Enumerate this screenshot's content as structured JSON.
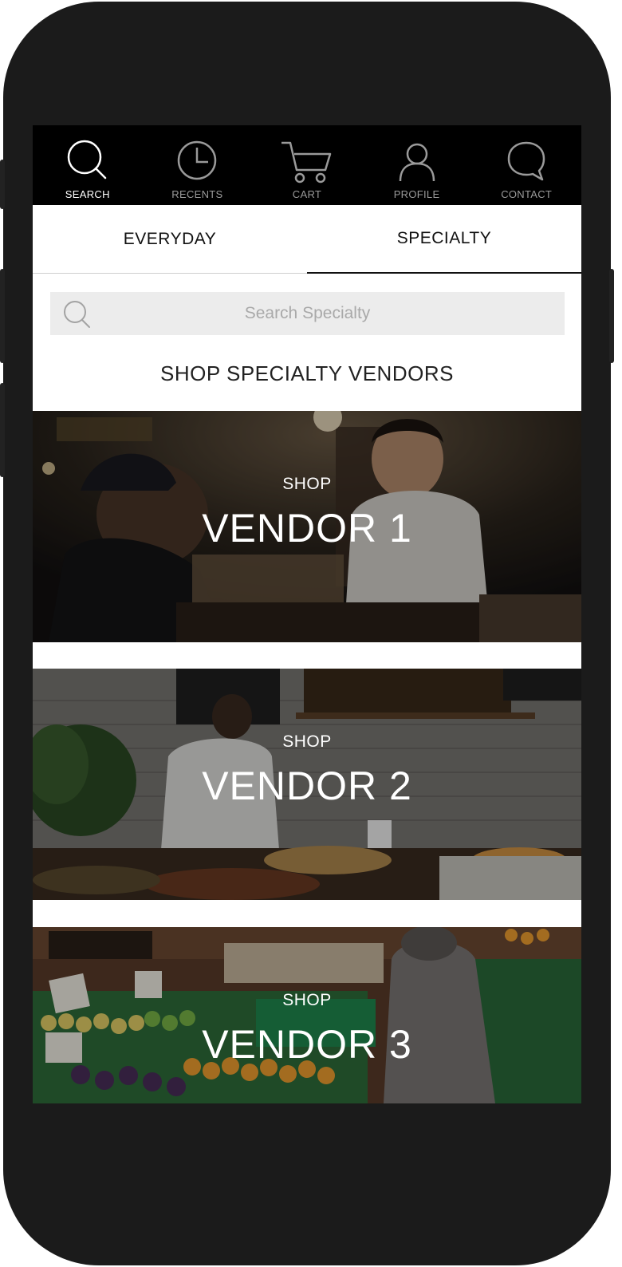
{
  "nav": {
    "items": [
      {
        "label": "SEARCH",
        "icon": "search-icon",
        "active": true
      },
      {
        "label": "RECENTS",
        "icon": "clock-icon",
        "active": false
      },
      {
        "label": "CART",
        "icon": "cart-icon",
        "active": false
      },
      {
        "label": "PROFILE",
        "icon": "user-icon",
        "active": false
      },
      {
        "label": "CONTACT",
        "icon": "chat-bubble-icon",
        "active": false
      }
    ]
  },
  "tabs": [
    {
      "label": "EVERYDAY",
      "active": false
    },
    {
      "label": "SPECIALTY",
      "active": true
    }
  ],
  "search": {
    "placeholder": "Search Specialty",
    "value": ""
  },
  "section_title": "SHOP SPECIALTY VENDORS",
  "vendors": [
    {
      "kicker": "SHOP",
      "name": "VENDOR 1"
    },
    {
      "kicker": "SHOP",
      "name": "VENDOR 2"
    },
    {
      "kicker": "SHOP",
      "name": "VENDOR 3"
    }
  ],
  "colors": {
    "frame": "#1b1b1b",
    "nav_bg": "#000000",
    "nav_active": "#ffffff",
    "nav_inactive": "#9a9a9a",
    "search_bg": "#ececec"
  }
}
